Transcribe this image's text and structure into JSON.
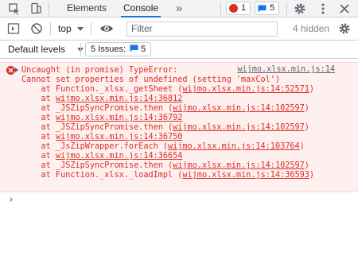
{
  "tabs": {
    "elements": "Elements",
    "console": "Console",
    "more": "»"
  },
  "badges": {
    "errors": "1",
    "messages": "5"
  },
  "toolbar": {
    "context": "top",
    "filter_placeholder": "Filter",
    "hidden": "4 hidden"
  },
  "levels": {
    "label": "Default levels",
    "issues_label": "5 Issues:",
    "issues_count": "5"
  },
  "error": {
    "title": "Uncaught (in promise) TypeError:",
    "source": "wijmo.xlsx.min.js:14",
    "lines": [
      "Cannot set properties of undefined (setting 'maxCol')",
      "    at Function._xlsx._getSheet (",
      "    at ",
      "    at _JSZipSyncPromise.then (",
      "    at ",
      "    at _JSZipSyncPromise.then (",
      "    at ",
      "    at _JsZipWrapper.forEach (",
      "    at ",
      "    at _JSZipSyncPromise.then (",
      "    at Function._xlsx._loadImpl ("
    ],
    "links": [
      "",
      "wijmo.xlsx.min.js:14:52571",
      "wijmo.xlsx.min.js:14:36812",
      "wijmo.xlsx.min.js:14:102597",
      "wijmo.xlsx.min.js:14:36792",
      "wijmo.xlsx.min.js:14:102597",
      "wijmo.xlsx.min.js:14:36750",
      "wijmo.xlsx.min.js:14:103764",
      "wijmo.xlsx.min.js:14:36654",
      "wijmo.xlsx.min.js:14:102597",
      "wijmo.xlsx.min.js:14:36593"
    ],
    "close_paren": ")"
  },
  "prompt": "›"
}
